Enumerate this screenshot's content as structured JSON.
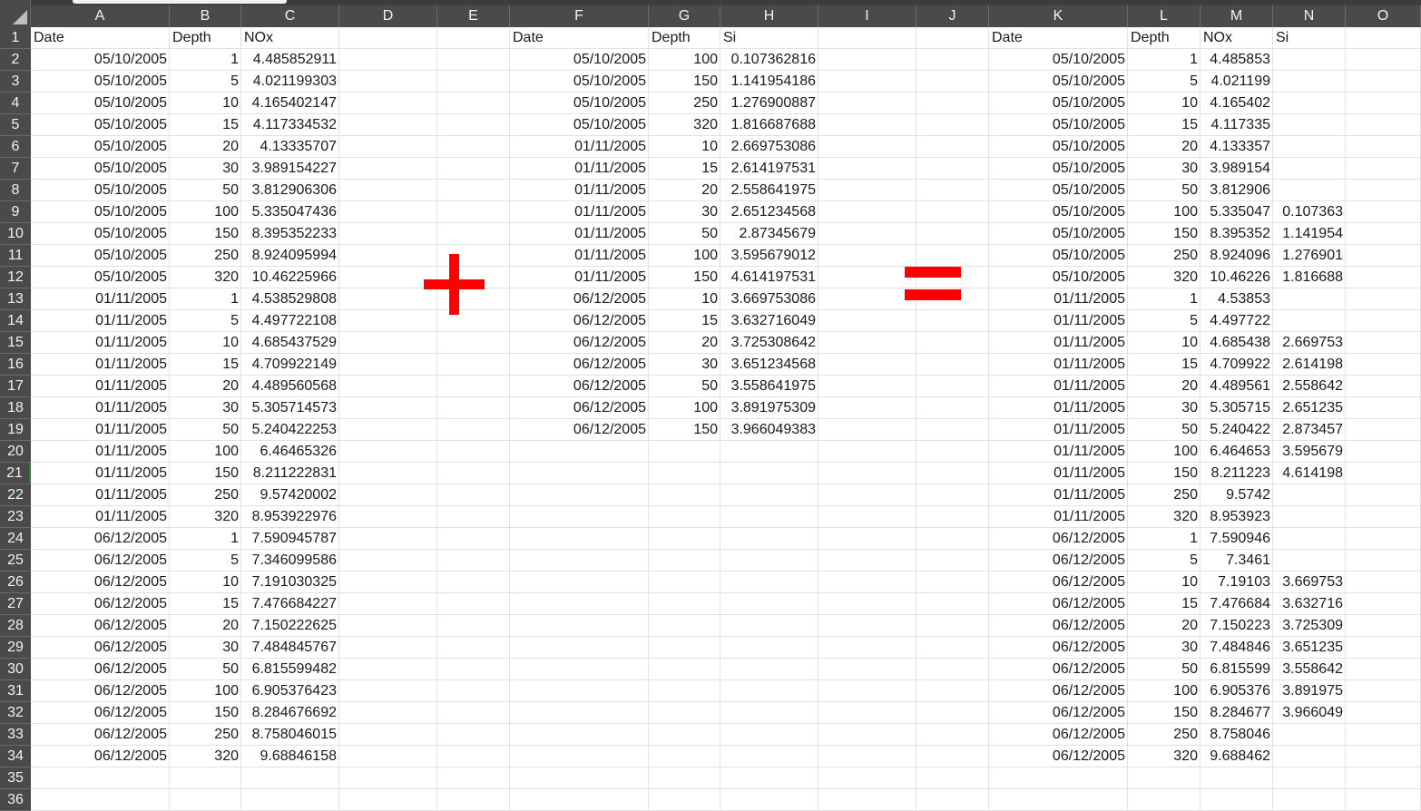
{
  "columns": [
    "A",
    "B",
    "C",
    "D",
    "E",
    "F",
    "G",
    "H",
    "I",
    "J",
    "K",
    "L",
    "M",
    "N",
    "O"
  ],
  "row_numbers": [
    "1",
    "2",
    "3",
    "4",
    "5",
    "6",
    "7",
    "8",
    "9",
    "10",
    "11",
    "12",
    "13",
    "14",
    "15",
    "16",
    "17",
    "18",
    "19",
    "20",
    "21",
    "22",
    "23",
    "24",
    "25",
    "26",
    "27",
    "28",
    "29",
    "30",
    "31",
    "32",
    "33",
    "34",
    "35",
    "36"
  ],
  "active_row": "21",
  "colors": {
    "header_bg": "#4a4a4a",
    "grid": "#e1e1e1",
    "symbol": "#ff0000",
    "active_row_marker": "#2e7d32"
  },
  "table1": {
    "headers": [
      "Date",
      "Depth",
      "NOx"
    ],
    "rows": [
      [
        "05/10/2005",
        "1",
        "4.485852911"
      ],
      [
        "05/10/2005",
        "5",
        "4.021199303"
      ],
      [
        "05/10/2005",
        "10",
        "4.165402147"
      ],
      [
        "05/10/2005",
        "15",
        "4.117334532"
      ],
      [
        "05/10/2005",
        "20",
        "4.13335707"
      ],
      [
        "05/10/2005",
        "30",
        "3.989154227"
      ],
      [
        "05/10/2005",
        "50",
        "3.812906306"
      ],
      [
        "05/10/2005",
        "100",
        "5.335047436"
      ],
      [
        "05/10/2005",
        "150",
        "8.395352233"
      ],
      [
        "05/10/2005",
        "250",
        "8.924095994"
      ],
      [
        "05/10/2005",
        "320",
        "10.46225966"
      ],
      [
        "01/11/2005",
        "1",
        "4.538529808"
      ],
      [
        "01/11/2005",
        "5",
        "4.497722108"
      ],
      [
        "01/11/2005",
        "10",
        "4.685437529"
      ],
      [
        "01/11/2005",
        "15",
        "4.709922149"
      ],
      [
        "01/11/2005",
        "20",
        "4.489560568"
      ],
      [
        "01/11/2005",
        "30",
        "5.305714573"
      ],
      [
        "01/11/2005",
        "50",
        "5.240422253"
      ],
      [
        "01/11/2005",
        "100",
        "6.46465326"
      ],
      [
        "01/11/2005",
        "150",
        "8.211222831"
      ],
      [
        "01/11/2005",
        "250",
        "9.57420002"
      ],
      [
        "01/11/2005",
        "320",
        "8.953922976"
      ],
      [
        "06/12/2005",
        "1",
        "7.590945787"
      ],
      [
        "06/12/2005",
        "5",
        "7.346099586"
      ],
      [
        "06/12/2005",
        "10",
        "7.191030325"
      ],
      [
        "06/12/2005",
        "15",
        "7.476684227"
      ],
      [
        "06/12/2005",
        "20",
        "7.150222625"
      ],
      [
        "06/12/2005",
        "30",
        "7.484845767"
      ],
      [
        "06/12/2005",
        "50",
        "6.815599482"
      ],
      [
        "06/12/2005",
        "100",
        "6.905376423"
      ],
      [
        "06/12/2005",
        "150",
        "8.284676692"
      ],
      [
        "06/12/2005",
        "250",
        "8.758046015"
      ],
      [
        "06/12/2005",
        "320",
        "9.68846158"
      ]
    ]
  },
  "table2": {
    "headers": [
      "Date",
      "Depth",
      "Si"
    ],
    "rows": [
      [
        "05/10/2005",
        "100",
        "0.107362816"
      ],
      [
        "05/10/2005",
        "150",
        "1.141954186"
      ],
      [
        "05/10/2005",
        "250",
        "1.276900887"
      ],
      [
        "05/10/2005",
        "320",
        "1.816687688"
      ],
      [
        "01/11/2005",
        "10",
        "2.669753086"
      ],
      [
        "01/11/2005",
        "15",
        "2.614197531"
      ],
      [
        "01/11/2005",
        "20",
        "2.558641975"
      ],
      [
        "01/11/2005",
        "30",
        "2.651234568"
      ],
      [
        "01/11/2005",
        "50",
        "2.87345679"
      ],
      [
        "01/11/2005",
        "100",
        "3.595679012"
      ],
      [
        "01/11/2005",
        "150",
        "4.614197531"
      ],
      [
        "06/12/2005",
        "10",
        "3.669753086"
      ],
      [
        "06/12/2005",
        "15",
        "3.632716049"
      ],
      [
        "06/12/2005",
        "20",
        "3.725308642"
      ],
      [
        "06/12/2005",
        "30",
        "3.651234568"
      ],
      [
        "06/12/2005",
        "50",
        "3.558641975"
      ],
      [
        "06/12/2005",
        "100",
        "3.891975309"
      ],
      [
        "06/12/2005",
        "150",
        "3.966049383"
      ]
    ]
  },
  "table3": {
    "headers": [
      "Date",
      "Depth",
      "NOx",
      "Si"
    ],
    "rows": [
      [
        "05/10/2005",
        "1",
        "4.485853",
        ""
      ],
      [
        "05/10/2005",
        "5",
        "4.021199",
        ""
      ],
      [
        "05/10/2005",
        "10",
        "4.165402",
        ""
      ],
      [
        "05/10/2005",
        "15",
        "4.117335",
        ""
      ],
      [
        "05/10/2005",
        "20",
        "4.133357",
        ""
      ],
      [
        "05/10/2005",
        "30",
        "3.989154",
        ""
      ],
      [
        "05/10/2005",
        "50",
        "3.812906",
        ""
      ],
      [
        "05/10/2005",
        "100",
        "5.335047",
        "0.107363"
      ],
      [
        "05/10/2005",
        "150",
        "8.395352",
        "1.141954"
      ],
      [
        "05/10/2005",
        "250",
        "8.924096",
        "1.276901"
      ],
      [
        "05/10/2005",
        "320",
        "10.46226",
        "1.816688"
      ],
      [
        "01/11/2005",
        "1",
        "4.53853",
        ""
      ],
      [
        "01/11/2005",
        "5",
        "4.497722",
        ""
      ],
      [
        "01/11/2005",
        "10",
        "4.685438",
        "2.669753"
      ],
      [
        "01/11/2005",
        "15",
        "4.709922",
        "2.614198"
      ],
      [
        "01/11/2005",
        "20",
        "4.489561",
        "2.558642"
      ],
      [
        "01/11/2005",
        "30",
        "5.305715",
        "2.651235"
      ],
      [
        "01/11/2005",
        "50",
        "5.240422",
        "2.873457"
      ],
      [
        "01/11/2005",
        "100",
        "6.464653",
        "3.595679"
      ],
      [
        "01/11/2005",
        "150",
        "8.211223",
        "4.614198"
      ],
      [
        "01/11/2005",
        "250",
        "9.5742",
        ""
      ],
      [
        "01/11/2005",
        "320",
        "8.953923",
        ""
      ],
      [
        "06/12/2005",
        "1",
        "7.590946",
        ""
      ],
      [
        "06/12/2005",
        "5",
        "7.3461",
        ""
      ],
      [
        "06/12/2005",
        "10",
        "7.19103",
        "3.669753"
      ],
      [
        "06/12/2005",
        "15",
        "7.476684",
        "3.632716"
      ],
      [
        "06/12/2005",
        "20",
        "7.150223",
        "3.725309"
      ],
      [
        "06/12/2005",
        "30",
        "7.484846",
        "3.651235"
      ],
      [
        "06/12/2005",
        "50",
        "6.815599",
        "3.558642"
      ],
      [
        "06/12/2005",
        "100",
        "6.905376",
        "3.891975"
      ],
      [
        "06/12/2005",
        "150",
        "8.284677",
        "3.966049"
      ],
      [
        "06/12/2005",
        "250",
        "8.758046",
        ""
      ],
      [
        "06/12/2005",
        "320",
        "9.688462",
        ""
      ]
    ]
  },
  "symbols": {
    "plus": "plus-symbol",
    "equals": "equals-symbol"
  }
}
